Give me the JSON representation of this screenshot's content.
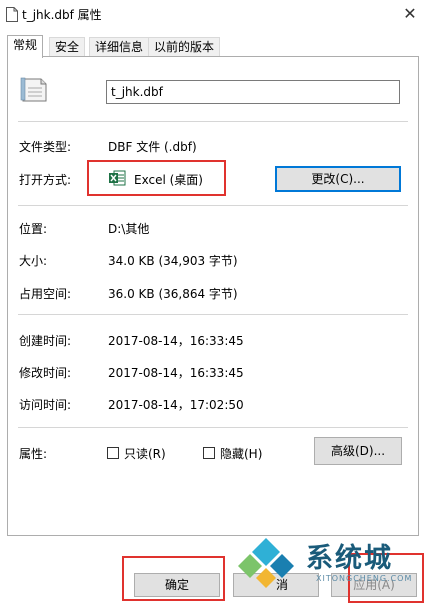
{
  "window": {
    "title": "t_jhk.dbf 属性",
    "close_glyph": "✕"
  },
  "tabs": [
    {
      "label": "常规",
      "active": true
    },
    {
      "label": "安全",
      "active": false
    },
    {
      "label": "详细信息",
      "active": false
    },
    {
      "label": "以前的版本",
      "active": false
    }
  ],
  "general": {
    "file_name": "t_jhk.dbf",
    "file_type_label": "文件类型:",
    "file_type_value": "DBF 文件 (.dbf)",
    "open_with_label": "打开方式:",
    "open_with_value": "Excel (桌面)",
    "change_button": "更改(C)...",
    "location_label": "位置:",
    "location_value": "D:\\其他",
    "size_label": "大小:",
    "size_value": "34.0 KB (34,903 字节)",
    "size_on_disk_label": "占用空间:",
    "size_on_disk_value": "36.0 KB (36,864 字节)",
    "created_label": "创建时间:",
    "created_value": "2017-08-14，16:33:45",
    "modified_label": "修改时间:",
    "modified_value": "2017-08-14，16:33:45",
    "accessed_label": "访问时间:",
    "accessed_value": "2017-08-14，17:02:50",
    "attributes_label": "属性:",
    "readonly_label": "只读(R)",
    "hidden_label": "隐藏(H)",
    "advanced_button": "高级(D)..."
  },
  "footer": {
    "ok_button": "确定",
    "cancel_button": "消",
    "apply_button": "应用(A)"
  },
  "watermark": {
    "text": "系统城",
    "sub": "XITONGCHENG.COM"
  },
  "colors": {
    "highlight_red": "#e0322e",
    "focus_blue": "#0078d7",
    "excel_green": "#1e7145"
  }
}
